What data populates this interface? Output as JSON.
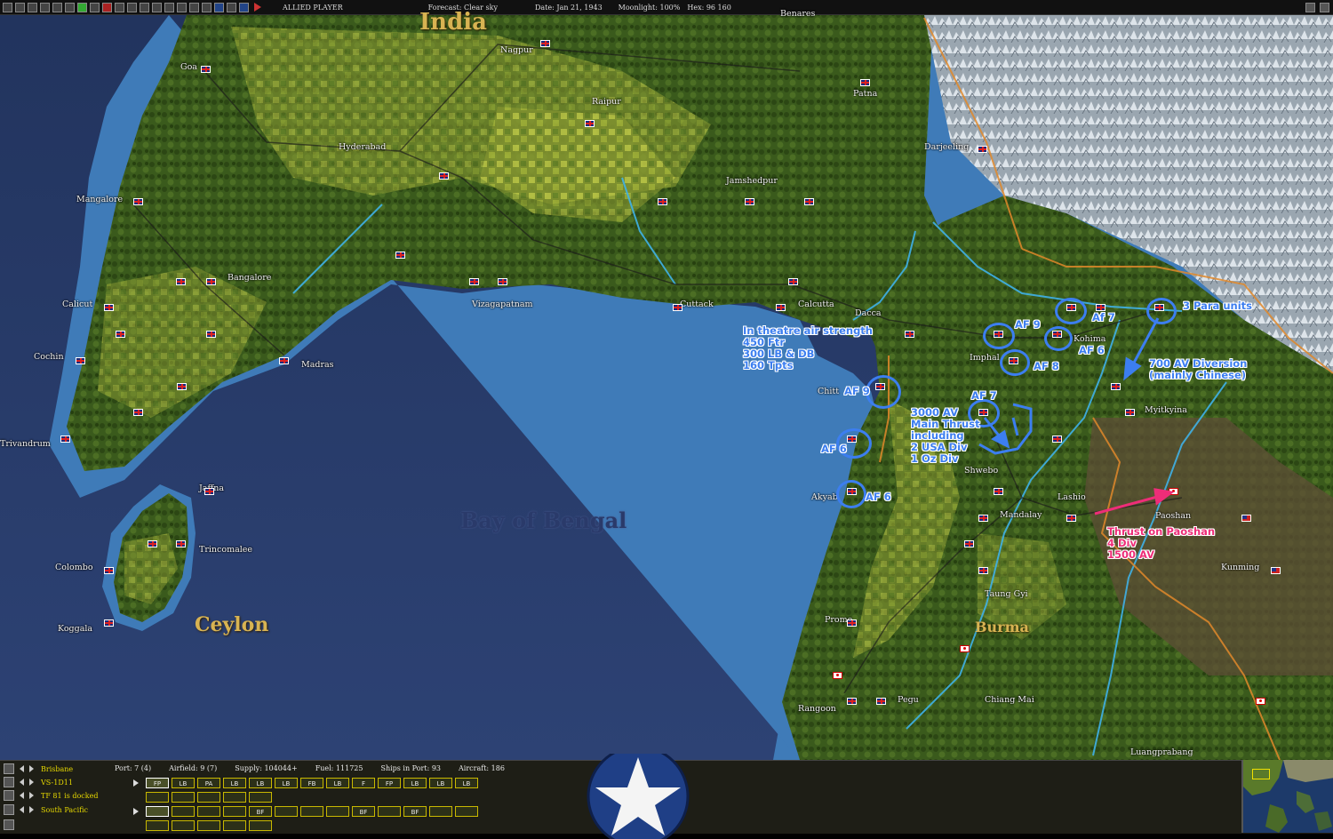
{
  "topbar": {
    "side_label": "ALLIED PLAYER",
    "forecast": "Forecast: Clear sky",
    "date": "Date: Jan 21, 1943",
    "moonlight": "Moonlight: 100%",
    "hex": "Hex: 96 160"
  },
  "map": {
    "regions": {
      "india": "India",
      "ceylon": "Ceylon",
      "burma": "Burma"
    },
    "sea": "Bay of Bengal",
    "places": {
      "benares": "Benares",
      "goa": "Goa",
      "nagpur": "Nagpur",
      "patna": "Patna",
      "raipur": "Raipur",
      "hyderabad": "Hyderabad",
      "darjeeling": "Darjeeling",
      "mangalore": "Mangalore",
      "jamshedpur": "Jamshedpur",
      "bangalore": "Bangalore",
      "calicut": "Calicut",
      "vizagapatnam": "Vizagapatnam",
      "cuttack": "Cuttack",
      "calcutta": "Calcutta",
      "dacca": "Dacca",
      "kohima": "Kohima",
      "cochin": "Cochin",
      "madras": "Madras",
      "imphal": "Imphal",
      "chittagong": "Chitt",
      "myitkyina": "Myitkyina",
      "trivandrum": "Trivandrum",
      "shwebo": "Shwebo",
      "jaffna": "Jaffna",
      "lashio": "Lashio",
      "akyab": "Akyab",
      "mandalay": "Mandalay",
      "paoshan": "Paoshan",
      "trincomalee": "Trincomalee",
      "colombo": "Colombo",
      "kunming": "Kunming",
      "taunggyi": "Taung Gyi",
      "koggala": "Koggala",
      "prome": "Prome",
      "rangoon": "Rangoon",
      "pegu": "Pegu",
      "chiangmai": "Chiang Mai",
      "luangprabang": "Luangprabang"
    }
  },
  "annotations": {
    "air_strength": [
      "In theatre air strength",
      "450 Ftr",
      "300 LB & DB",
      "160 Tpts"
    ],
    "main_thrust": [
      "3000 AV",
      "Main Thrust",
      "including",
      "2 USA Div",
      "1 Oz Div"
    ],
    "diversion": [
      "700 AV Diversion",
      "(mainly Chinese)"
    ],
    "para": "3 Para units",
    "paoshan_thrust": [
      "Thrust on Paoshan",
      "4 Div",
      "1500 AV"
    ],
    "af_labels": {
      "af9_north": "AF 9",
      "af7_north": "Af 7",
      "af6_kohima": "AF 6",
      "af8": "AF 8",
      "af9_chitt": "AF 9",
      "af7_south": "AF 7",
      "af6_coast": "AF 6",
      "af6_akyab": "AF 6"
    }
  },
  "bottom_panel": {
    "rows": [
      "Brisbane",
      "VS-1D11",
      "TF 81 is docked",
      "South Pacific"
    ],
    "stats": {
      "port": "Port: 7 (4)",
      "airfield": "Airfield: 9 (7)",
      "supply": "Supply: 104044+",
      "fuel": "Fuel: 111725",
      "ships": "Ships in Port: 93",
      "aircraft": "Aircraft: 186"
    },
    "aircraft_units": [
      "FP",
      "LB",
      "PA",
      "LB",
      "LB",
      "LB",
      "FB",
      "LB",
      "F",
      "FP",
      "LB",
      "LB",
      "LB"
    ],
    "facility_units": [
      "",
      "",
      "",
      "",
      "BF",
      "",
      "",
      "",
      "BF",
      "",
      "BF",
      "",
      ""
    ]
  }
}
